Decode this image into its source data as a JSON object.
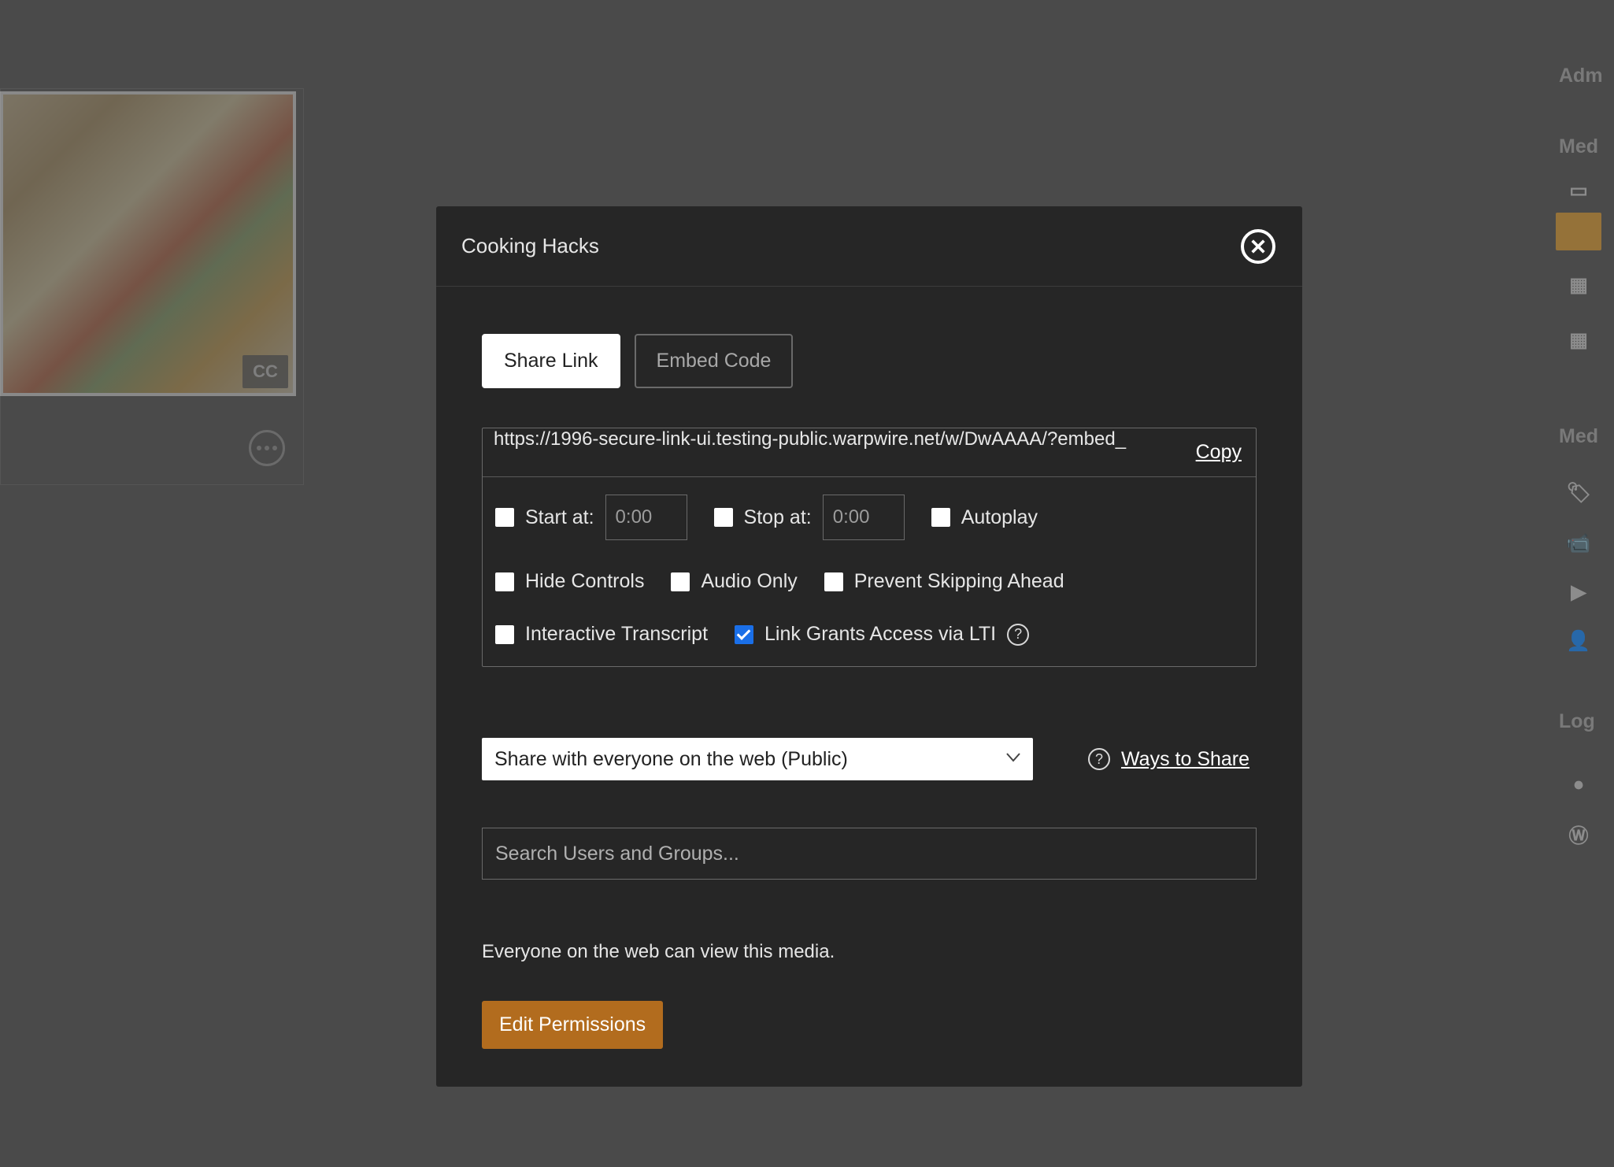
{
  "sidebar": {
    "section1": "Adm",
    "section2": "Med",
    "section3": "Med",
    "section4": "Log",
    "cc_badge": "CC"
  },
  "modal": {
    "title": "Cooking Hacks",
    "tabs": {
      "share": "Share Link",
      "embed": "Embed Code"
    },
    "link": "https://1996-secure-link-ui.testing-public.warpwire.net/w/DwAAAA/?embed_",
    "copy": "Copy",
    "options": {
      "start_label": "Start at:",
      "start_value": "0:00",
      "stop_label": "Stop at:",
      "stop_value": "0:00",
      "autoplay": "Autoplay",
      "hide_controls": "Hide Controls",
      "audio_only": "Audio Only",
      "prevent_skipping": "Prevent Skipping Ahead",
      "interactive_transcript": "Interactive Transcript",
      "link_grants": "Link Grants Access via LTI"
    },
    "share_select": "Share with everyone on the web (Public)",
    "ways_to_share": "Ways to Share",
    "search_placeholder": "Search Users and Groups...",
    "info": "Everyone on the web can view this media.",
    "edit_permissions": "Edit Permissions",
    "help_glyph": "?"
  }
}
